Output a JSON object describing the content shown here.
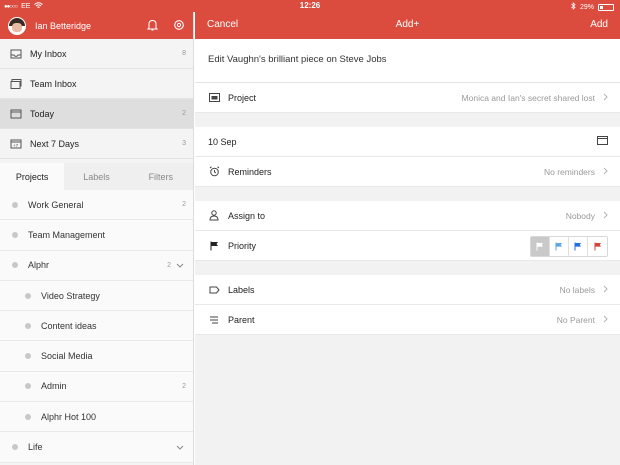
{
  "status_bar": {
    "carrier": "EE",
    "time": "12:26",
    "battery": "29%",
    "battery_level": 0.29
  },
  "sidebar": {
    "user_name": "Ian Betteridge",
    "nav": [
      {
        "label": "My Inbox",
        "count": "8",
        "icon": "inbox-icon"
      },
      {
        "label": "Team Inbox",
        "count": "",
        "icon": "team-inbox-icon"
      },
      {
        "label": "Today",
        "count": "2",
        "icon": "calendar-today-icon"
      },
      {
        "label": "Next 7 Days",
        "count": "3",
        "icon": "calendar-week-icon"
      }
    ],
    "tabs": [
      "Projects",
      "Labels",
      "Filters"
    ],
    "active_tab": "Projects",
    "projects": [
      {
        "label": "Work General",
        "count": "2"
      },
      {
        "label": "Team Management",
        "count": ""
      },
      {
        "label": "Alphr",
        "count": "2",
        "expanded": true
      },
      {
        "label": "Video Strategy",
        "count": ""
      },
      {
        "label": "Content ideas",
        "count": ""
      },
      {
        "label": "Social Media",
        "count": ""
      },
      {
        "label": "Admin",
        "count": "2"
      },
      {
        "label": "Alphr Hot 100",
        "count": ""
      },
      {
        "label": "Life",
        "count": "",
        "expanded": false
      }
    ]
  },
  "editor": {
    "cancel_label": "Cancel",
    "title": "Add+",
    "add_label": "Add",
    "task_text": "Edit Vaughn's brilliant piece on Steve Jobs",
    "project": {
      "label": "Project",
      "value": "Monica and Ian's secret shared lost"
    },
    "due_date": "10 Sep",
    "reminders": {
      "label": "Reminders",
      "value": "No reminders"
    },
    "assign": {
      "label": "Assign to",
      "value": "Nobody"
    },
    "priority": {
      "label": "Priority",
      "selected": 4
    },
    "labels": {
      "label": "Labels",
      "value": "No labels"
    },
    "parent": {
      "label": "Parent",
      "value": "No Parent"
    }
  },
  "colors": {
    "accent": "#db4c3f",
    "priority_1": "#d1453b",
    "priority_2": "#246fe0",
    "priority_3": "#5aa9e6",
    "priority_4": "#ffffff"
  }
}
